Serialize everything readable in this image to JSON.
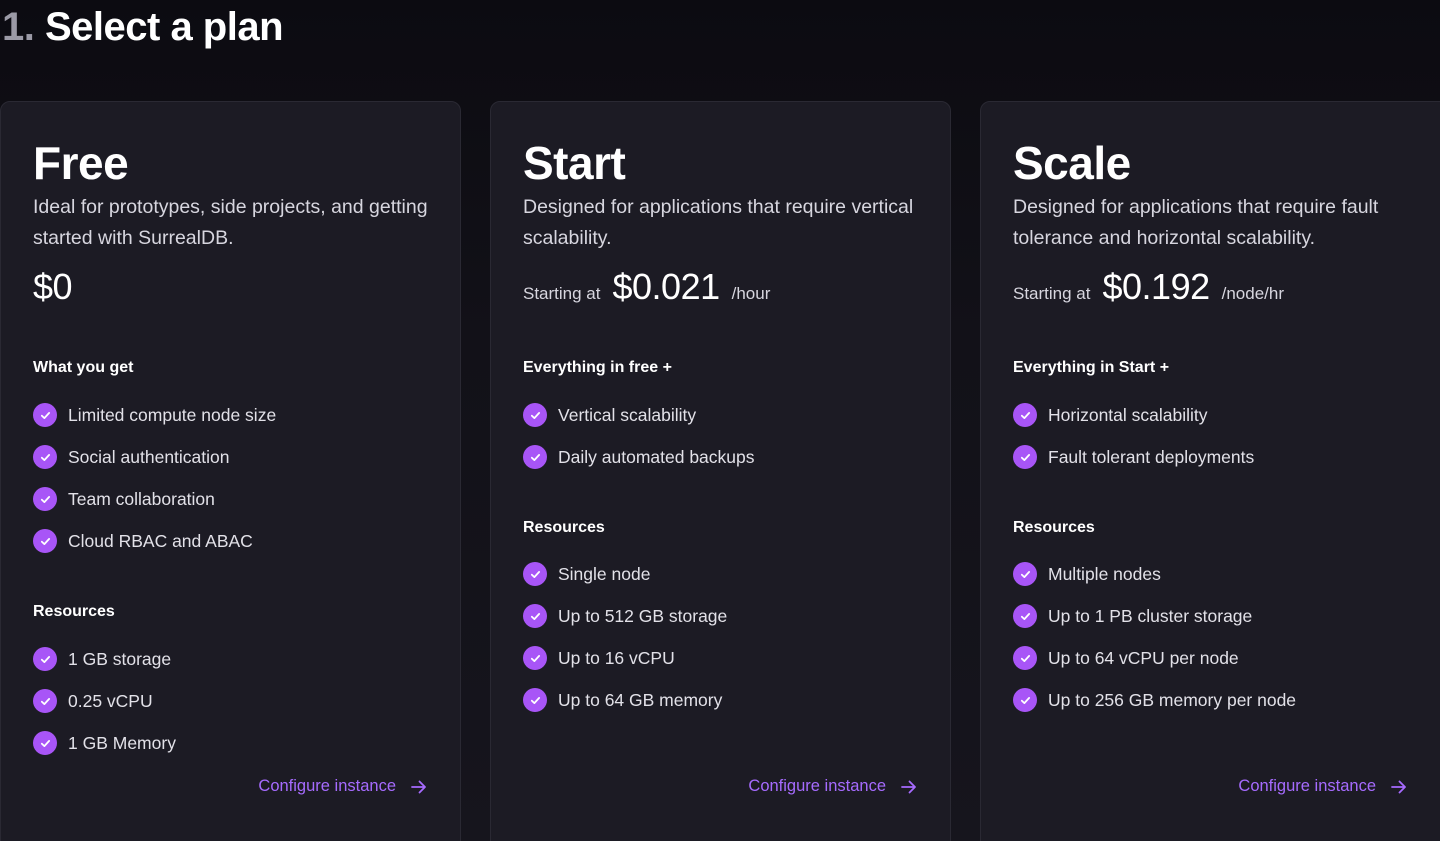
{
  "header": {
    "step": "1.",
    "title": "Select a plan"
  },
  "colors": {
    "accent": "#a855f7",
    "link": "#a66bff",
    "card_bg": "#1c1b24"
  },
  "icons": {
    "feature": "check-circle-icon",
    "cta": "arrow-right-icon"
  },
  "plans": [
    {
      "name": "Free",
      "description": "Ideal for prototypes, side projects, and getting started with SurrealDB.",
      "price_prefix": "",
      "price": "$0",
      "price_unit": "",
      "features_title": "What you get",
      "features": [
        "Limited compute node size",
        "Social authentication",
        "Team collaboration",
        "Cloud RBAC and ABAC"
      ],
      "resources_title": "Resources",
      "resources": [
        "1 GB storage",
        "0.25 vCPU",
        "1 GB Memory"
      ],
      "cta": "Configure instance"
    },
    {
      "name": "Start",
      "description": "Designed for applications that require vertical scalability.",
      "price_prefix": "Starting at",
      "price": "$0.021",
      "price_unit": "/hour",
      "features_title": "Everything in free +",
      "features": [
        "Vertical scalability",
        "Daily automated backups"
      ],
      "resources_title": "Resources",
      "resources": [
        "Single node",
        "Up to 512 GB storage",
        "Up to 16 vCPU",
        "Up to 64 GB memory"
      ],
      "cta": "Configure instance"
    },
    {
      "name": "Scale",
      "description": "Designed for applications that require fault tolerance and horizontal scalability.",
      "price_prefix": "Starting at",
      "price": "$0.192",
      "price_unit": "/node/hr",
      "features_title": "Everything in Start +",
      "features": [
        "Horizontal scalability",
        "Fault tolerant deployments"
      ],
      "resources_title": "Resources",
      "resources": [
        "Multiple nodes",
        "Up to 1 PB cluster storage",
        "Up to 64 vCPU per node",
        "Up to 256 GB memory per node"
      ],
      "cta": "Configure instance"
    }
  ]
}
